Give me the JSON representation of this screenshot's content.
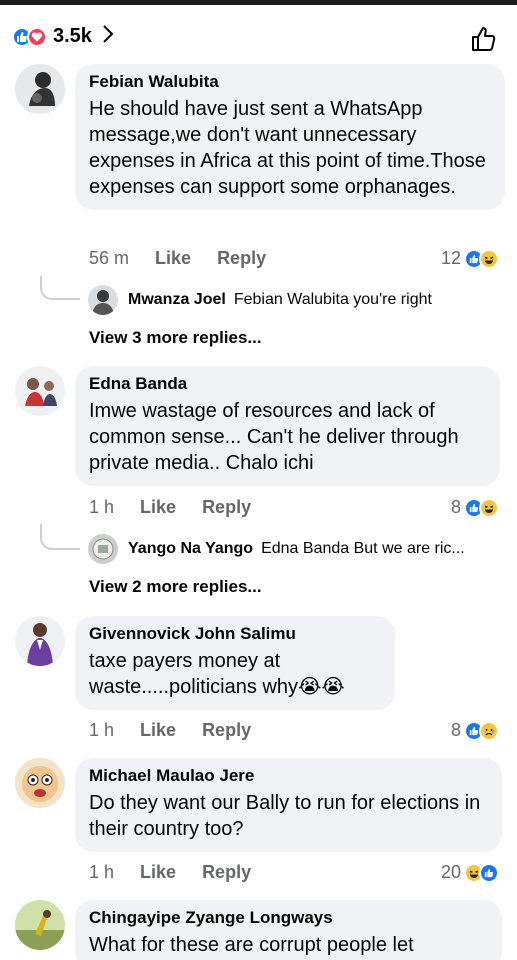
{
  "header": {
    "reaction_count": "3.5k",
    "chevron": ">"
  },
  "comments": [
    {
      "author": "Febian Walubita",
      "text": "He should have just sent a WhatsApp message,we don't want unnecessary expenses in Africa at this point of time.Those expenses can support some orphanages.",
      "age": "56 m",
      "like": "Like",
      "reply": "Reply",
      "reactions": "12",
      "reaction_icons": [
        "like-icon",
        "haha-icon"
      ],
      "reply_preview": {
        "author": "Mwanza Joel",
        "text": "Febian Walubita  you're right"
      },
      "view_more": "View 3 more replies..."
    },
    {
      "author": "Edna Banda",
      "text": "Imwe wastage of resources and lack of common sense... Can't he deliver through private media.. Chalo ichi",
      "age": "1 h",
      "like": "Like",
      "reply": "Reply",
      "reactions": "8",
      "reaction_icons": [
        "like-icon",
        "haha-icon"
      ],
      "reply_preview": {
        "author": "Yango Na Yango",
        "text": "Edna Banda But we are ric..."
      },
      "view_more": "View 2 more replies..."
    },
    {
      "author": "Givennovick John Salimu",
      "text": "taxe payers money at waste.....politicians why😭😭",
      "age": "1 h",
      "like": "Like",
      "reply": "Reply",
      "reactions": "8",
      "reaction_icons": [
        "like-icon",
        "sad-icon"
      ]
    },
    {
      "author": "Michael Maulao Jere",
      "text": "Do they want our Bally to run for elections in their country too?",
      "age": "1 h",
      "like": "Like",
      "reply": "Reply",
      "reactions": "20",
      "reaction_icons": [
        "haha-icon",
        "like-icon"
      ]
    },
    {
      "author": "Chingayipe Zyange Longways",
      "text": "What for these are corrupt people let"
    }
  ],
  "colors": {
    "like": "#1877f2",
    "love": "#f33e58",
    "haha": "#f7c53d",
    "bubble": "#f0f2f5",
    "meta": "#65676b"
  }
}
